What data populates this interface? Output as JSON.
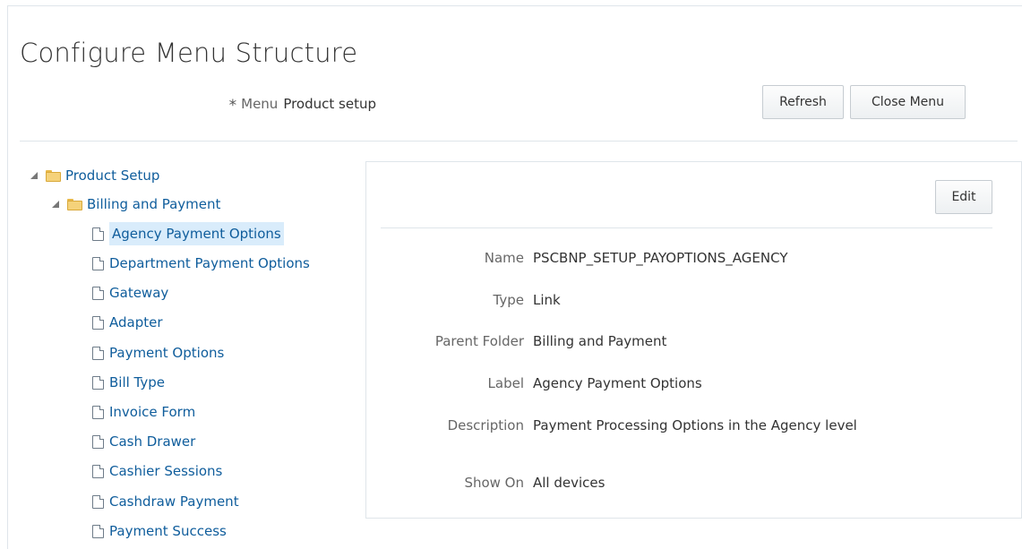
{
  "page": {
    "title": "Configure Menu Structure"
  },
  "menu_selector": {
    "required_mark": "*",
    "label": "Menu",
    "value": "Product setup"
  },
  "toolbar": {
    "refresh_label": "Refresh",
    "close_menu_label": "Close Menu"
  },
  "tree": {
    "root": {
      "label": "Product Setup",
      "icon": "folder-icon",
      "expanded": true
    },
    "folder": {
      "label": "Billing and Payment",
      "icon": "folder-icon",
      "expanded": true
    },
    "items": [
      {
        "label": "Agency Payment Options",
        "selected": true
      },
      {
        "label": "Department Payment Options"
      },
      {
        "label": "Gateway"
      },
      {
        "label": "Adapter"
      },
      {
        "label": "Payment Options"
      },
      {
        "label": "Bill Type"
      },
      {
        "label": "Invoice Form"
      },
      {
        "label": "Cash Drawer"
      },
      {
        "label": "Cashier Sessions"
      },
      {
        "label": "Cashdraw Payment"
      },
      {
        "label": "Payment Success"
      }
    ]
  },
  "detail": {
    "edit_label": "Edit",
    "fields": [
      {
        "label": "Name",
        "value": "PSCBNP_SETUP_PAYOPTIONS_AGENCY"
      },
      {
        "label": "Type",
        "value": "Link"
      },
      {
        "label": "Parent Folder",
        "value": "Billing and Payment"
      },
      {
        "label": "Label",
        "value": "Agency Payment Options"
      },
      {
        "label": "Description",
        "value": "Payment Processing Options in the Agency level"
      },
      {
        "label": "Show On",
        "value": "All devices"
      }
    ]
  },
  "colors": {
    "link": "#0f5d9c",
    "selection": "#d9ecfb",
    "border": "#dfe5ea"
  }
}
